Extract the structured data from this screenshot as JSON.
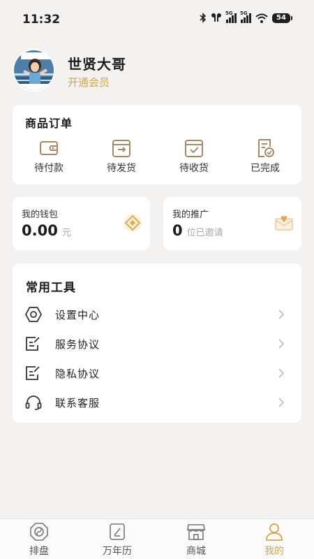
{
  "status_bar": {
    "time": "11:32",
    "network": "5G",
    "battery": "54"
  },
  "profile": {
    "name": "世贤大哥",
    "vip_link": "开通会员"
  },
  "orders": {
    "title": "商品订单",
    "items": [
      {
        "label": "待付款",
        "icon": "wallet-icon"
      },
      {
        "label": "待发货",
        "icon": "shipping-box-icon"
      },
      {
        "label": "待收货",
        "icon": "receive-box-icon"
      },
      {
        "label": "已完成",
        "icon": "completed-doc-icon"
      }
    ]
  },
  "wallet": {
    "title": "我的钱包",
    "value": "0.00",
    "unit": "元"
  },
  "promotion": {
    "title": "我的推广",
    "value": "0",
    "unit": "位已邀请"
  },
  "tools": {
    "title": "常用工具",
    "items": [
      {
        "label": "设置中心",
        "icon": "settings-icon"
      },
      {
        "label": "服务协议",
        "icon": "agreement-icon"
      },
      {
        "label": "隐私协议",
        "icon": "privacy-icon"
      },
      {
        "label": "联系客服",
        "icon": "headset-icon"
      }
    ]
  },
  "tabbar": {
    "items": [
      {
        "label": "排盘",
        "icon": "compass-icon"
      },
      {
        "label": "万年历",
        "icon": "calendar-icon"
      },
      {
        "label": "商城",
        "icon": "store-icon"
      },
      {
        "label": "我的",
        "icon": "user-icon",
        "active": true
      }
    ]
  },
  "colors": {
    "accent": "#d9a441",
    "background": "#f3f2f1",
    "card": "#ffffff"
  }
}
